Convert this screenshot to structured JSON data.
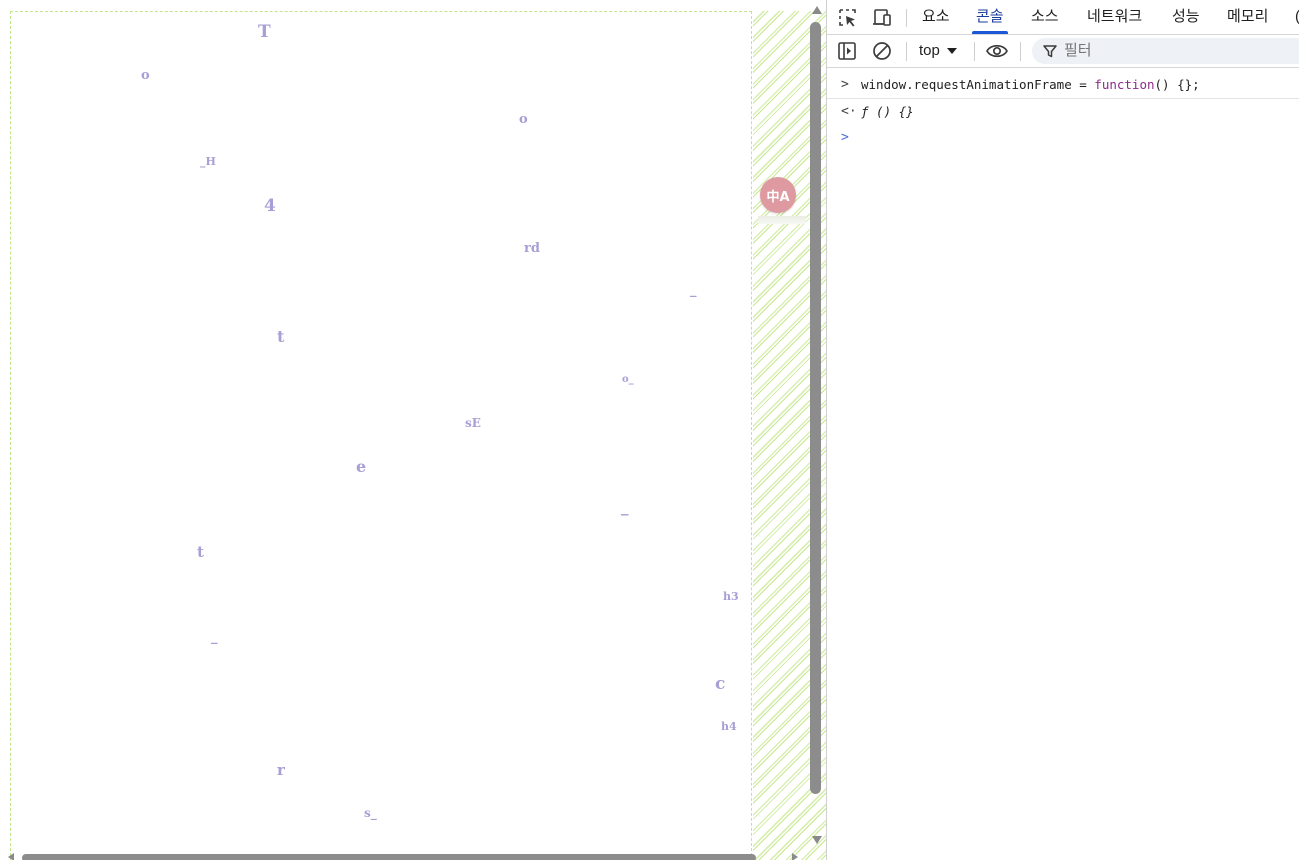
{
  "viewport": {
    "letters": [
      {
        "text": "T"
      },
      {
        "text": "o"
      },
      {
        "text": "o"
      },
      {
        "text": "_H"
      },
      {
        "text": "4"
      },
      {
        "text": "rd"
      },
      {
        "text": "_"
      },
      {
        "text": "t"
      },
      {
        "text": "o_"
      },
      {
        "text": "sE"
      },
      {
        "text": "e"
      },
      {
        "text": "_"
      },
      {
        "text": "t"
      },
      {
        "text": "h3"
      },
      {
        "text": "_"
      },
      {
        "text": "c"
      },
      {
        "text": "h4"
      },
      {
        "text": "r"
      },
      {
        "text": "s_"
      }
    ],
    "translate_badge": {
      "icon": "translate-icon",
      "label": "中A"
    }
  },
  "devtools": {
    "toolbar_icons": [
      "inspect-element-icon",
      "device-toolbar-icon"
    ],
    "tabs": [
      {
        "label": "요소",
        "active": false
      },
      {
        "label": "콘솔",
        "active": true
      },
      {
        "label": "소스",
        "active": false
      },
      {
        "label": "네트워크",
        "active": false
      },
      {
        "label": "성능",
        "active": false
      },
      {
        "label": "메모리",
        "active": false
      },
      {
        "label": "(",
        "active": false
      }
    ],
    "console_toolbar": {
      "sidebar_icon": "sidebar-toggle-icon",
      "clear_icon": "clear-console-icon",
      "context": "top",
      "eye_icon": "live-expression-icon",
      "filter_placeholder": "필터"
    },
    "console": {
      "input": {
        "prefix": ">",
        "code_before": "window.requestAnimationFrame = ",
        "keyword": "function",
        "code_after": "() {};"
      },
      "result": {
        "prefix": "<·",
        "text": "ƒ () {}"
      },
      "prompt": {
        "prefix": ">"
      }
    }
  },
  "colors": {
    "letter": "#a79fd6",
    "badge": "#de9aa0",
    "tab_active_underline": "#1b57d6",
    "keyword": "#8a2b8b",
    "stripe": "#c6e88e"
  }
}
